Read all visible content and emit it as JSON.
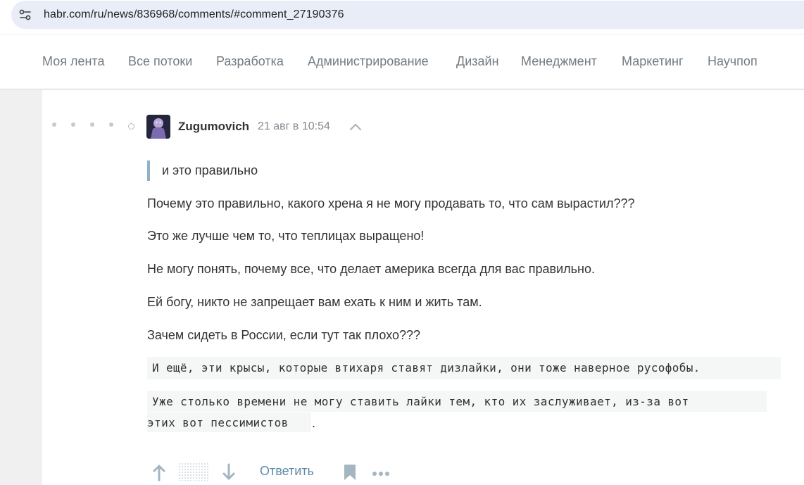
{
  "browser": {
    "url": "habr.com/ru/news/836968/comments/#comment_27190376",
    "site_info_icon": "tune-icon"
  },
  "nav": {
    "items": [
      {
        "label": "Моя лента"
      },
      {
        "label": "Все потоки"
      },
      {
        "label": "Разработка"
      },
      {
        "label": "Администрирование"
      },
      {
        "label": "Дизайн"
      },
      {
        "label": "Менеджмент"
      },
      {
        "label": "Маркетинг"
      },
      {
        "label": "Научпоп"
      }
    ]
  },
  "comment": {
    "author": "Zugumovich",
    "time": "21 авг в 10:54",
    "quote": "и это правильно",
    "paragraphs": [
      "Почему это правильно, какого хрена я не могу продавать то, что сам вырастил???",
      "Это же лучше чем то, что теплицах выращено!",
      "Не могу понять, почему все, что делает америка всегда для вас правильно.",
      "Ей богу, никто не запрещает вам ехать к ним и жить там.",
      "Зачем сидеть в России, если тут так плохо???"
    ],
    "code1": "И ещё, эти крысы, которые втихаря ставят дизлайки, они тоже наверное русофобы.",
    "code2_line1": "Уже столько времени не могу ставить лайки тем, кто их заслуживает, из-за вот",
    "code2_line2": "этих вот пессимистов",
    "code2_tail": ".",
    "actions": {
      "upvote_icon": "arrow-up-icon",
      "downvote_icon": "arrow-down-icon",
      "reply_label": "Ответить",
      "bookmark_icon": "bookmark-icon",
      "more_icon": "more-icon"
    }
  },
  "colors": {
    "link": "#5e8aa7",
    "quote_border": "#8eb2c7",
    "text": "#333333",
    "nav_text": "#717b83"
  }
}
